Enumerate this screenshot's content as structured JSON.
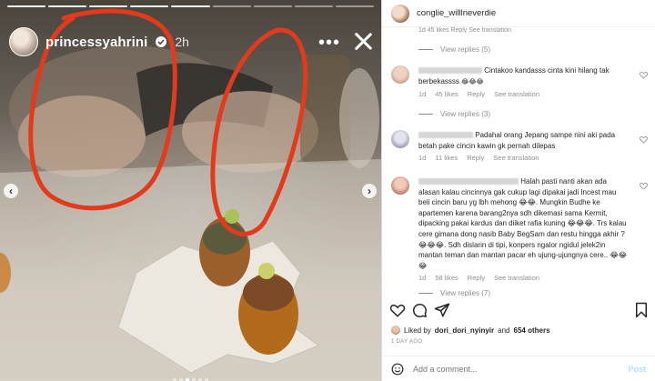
{
  "story": {
    "username": "princessyahrini",
    "time": "2h",
    "more_label": "•••",
    "progress_segments": 9,
    "progress_done": 5,
    "carousel_dots": 6,
    "carousel_active": 2
  },
  "post": {
    "username": "conglie_willlneverdie"
  },
  "comments": {
    "top_cut_text": "1d   45 likes   Reply   See translation",
    "view_replies_1": "View replies (5)",
    "view_replies_2": "View replies (3)",
    "view_replies_3": "View replies (7)",
    "items": [
      {
        "text": "Cintakoo kandasss cinta kini hilang tak berbekassss",
        "emoji": "😂😂😂",
        "age": "1d",
        "likes": "45 likes",
        "reply": "Reply",
        "translate": "See translation"
      },
      {
        "text": "Padahal orang Jepang sampe nini aki pada betah pake cincin kawin gk pernah dilepas",
        "emoji": "",
        "age": "1d",
        "likes": "11 likes",
        "reply": "Reply",
        "translate": "See translation"
      },
      {
        "text": "Halah pasti nanti akan ada alasan kalau cincinnya gak cukup lagi dipakai jadi Incest mau beli cincin baru yg lbh mehong 😂😂. Mungkin Budhe ke apartemen karena barang2nya sdh dikemasi sama Kermit, dipacking pakai kardus dan diiket rafia kuning 😂😂😂. Trs kalau cere gimana dong nasib Baby BegSam dan restu hingga akhir ? 😂😂😂. Sdh dislarin di tipi, konpers ngalor ngidul jelek2in mantan teman dan mantan pacar eh ujung-ujungnya cere.. 😂😂😂",
        "emoji": "",
        "age": "1d",
        "likes": "58 likes",
        "reply": "Reply",
        "translate": "See translation"
      }
    ]
  },
  "likes": {
    "prefix": "Liked by",
    "user": "dori_dori_nyinyir",
    "suffix": "and",
    "count": "654 others"
  },
  "date": "1 DAY AGO",
  "add_comment": {
    "placeholder": "Add a comment...",
    "post_label": "Post"
  },
  "colors": {
    "link": "#0095f6",
    "muted": "#8e8e8e",
    "red_circle": "#e23a1d"
  }
}
